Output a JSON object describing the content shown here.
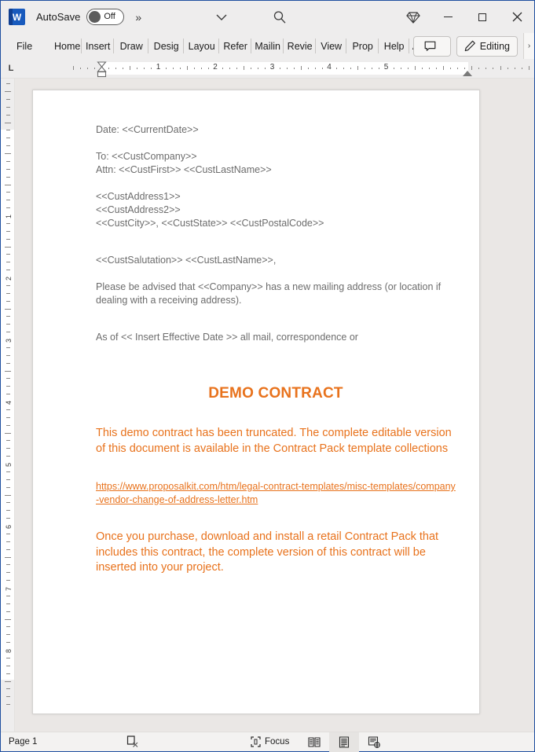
{
  "app": {
    "name": "Microsoft Word",
    "logo_text": "W"
  },
  "titlebar": {
    "autosave_label": "AutoSave",
    "autosave_state": "Off",
    "more_chevron": "»",
    "customize_chevron": "⌄",
    "search_icon": "search-icon",
    "copilot_icon": "diamond-icon",
    "minimize_label": "Minimize",
    "maximize_label": "Maximize",
    "close_label": "Close"
  },
  "ribbon": {
    "tabs": [
      {
        "label": "File",
        "truncated": false
      },
      {
        "label": "Home",
        "display": "Home",
        "truncated": true
      },
      {
        "label": "Insert",
        "display": "Insert",
        "truncated": true
      },
      {
        "label": "Draw",
        "display": "Draw",
        "truncated": false
      },
      {
        "label": "Design",
        "display": "Desig",
        "truncated": true
      },
      {
        "label": "Layout",
        "display": "Layou",
        "truncated": true
      },
      {
        "label": "References",
        "display": "Refer",
        "truncated": true
      },
      {
        "label": "Mailings",
        "display": "Mailin",
        "truncated": true
      },
      {
        "label": "Review",
        "display": "Revie",
        "truncated": true
      },
      {
        "label": "View",
        "display": "View",
        "truncated": false
      },
      {
        "label": "Proposal Kit",
        "display": "Prop",
        "truncated": true
      },
      {
        "label": "Help",
        "display": "Help",
        "truncated": false
      },
      {
        "label": "Acrobat",
        "display": "Acrob",
        "truncated": true
      }
    ],
    "comments_label": "",
    "editing_label": "Editing",
    "overflow_chevron": "›"
  },
  "ruler": {
    "tab_stop_marker": "L",
    "h_numbers": [
      1,
      2,
      3,
      4,
      5
    ],
    "v_numbers": [
      1,
      2,
      3,
      4,
      5,
      6,
      7,
      8
    ]
  },
  "document": {
    "paragraphs": [
      {
        "id": "p1",
        "style": "body",
        "text": "Date: <<CurrentDate>>"
      },
      {
        "id": "p2",
        "style": "body",
        "text": "To: <<CustCompany>>"
      },
      {
        "id": "p3",
        "style": "body",
        "text": "Attn: <<CustFirst>> <<CustLastName>>"
      },
      {
        "id": "p4",
        "style": "body",
        "text": "<<CustAddress1>>"
      },
      {
        "id": "p5",
        "style": "body",
        "text": "<<CustAddress2>>"
      },
      {
        "id": "p6",
        "style": "body",
        "text": "<<CustCity>>, <<CustState>> <<CustPostalCode>>"
      },
      {
        "id": "p7",
        "style": "body",
        "text": "<<CustSalutation>> <<CustLastName>>,"
      },
      {
        "id": "p8",
        "style": "body",
        "text": "Please be advised that <<Company>> has a new mailing address (or location if dealing with a receiving address)."
      },
      {
        "id": "p9",
        "style": "body",
        "text": "As of << Insert Effective Date >> all mail, correspondence or"
      },
      {
        "id": "p10",
        "style": "heading-orange",
        "text": "DEMO CONTRACT"
      },
      {
        "id": "p11",
        "style": "orange",
        "text": "This demo contract has been truncated. The complete editable version of this document is available in the Contract Pack template collections"
      },
      {
        "id": "p12",
        "style": "link",
        "text": "https://www.proposalkit.com/htm/legal-contract-templates/misc-templates/company-vendor-change-of-address-letter.htm"
      },
      {
        "id": "p13",
        "style": "orange",
        "text": "Once you purchase, download and install a retail Contract Pack that includes this contract, the complete version of this contract will be inserted into your project."
      }
    ],
    "colors": {
      "body_text": "#6c6c6c",
      "accent_orange": "#e8721c",
      "page_background": "#ffffff"
    }
  },
  "statusbar": {
    "page_label": "Page 1",
    "proofing_icon": "proofing-errors-icon",
    "focus_label": "Focus",
    "views": [
      {
        "name": "read-mode",
        "label": "Read Mode",
        "active": false
      },
      {
        "name": "print-layout",
        "label": "Print Layout",
        "active": true
      },
      {
        "name": "web-layout",
        "label": "Web Layout",
        "active": false
      }
    ]
  }
}
